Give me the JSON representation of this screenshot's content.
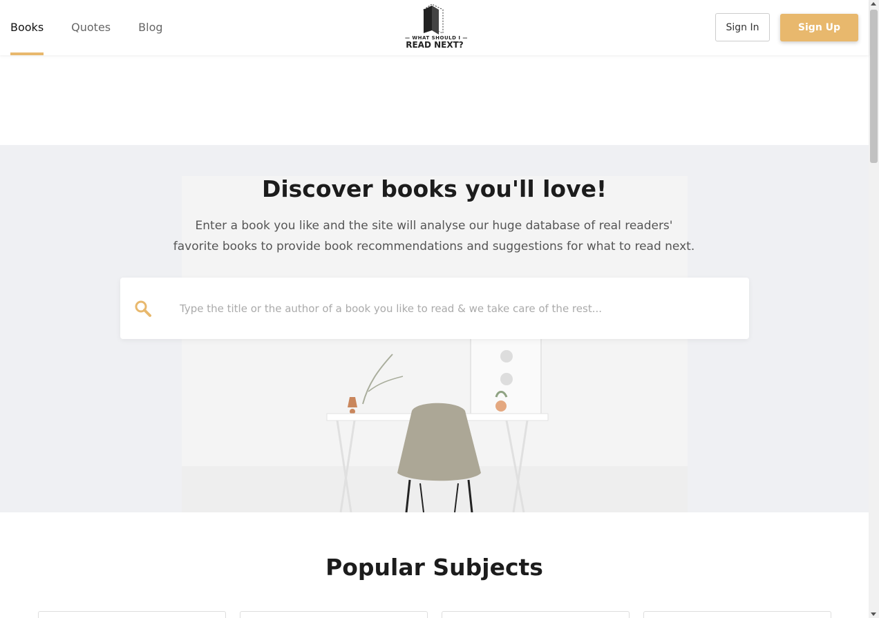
{
  "nav": {
    "items": [
      {
        "label": "Books",
        "active": true
      },
      {
        "label": "Quotes",
        "active": false
      },
      {
        "label": "Blog",
        "active": false
      }
    ]
  },
  "logo": {
    "line1": "— WHAT SHOULD I —",
    "line2": "READ NEXT?"
  },
  "auth": {
    "sign_in": "Sign In",
    "sign_up": "Sign Up"
  },
  "hero": {
    "title": "Discover books you'll love!",
    "subtitle": "Enter a book you like and the site will analyse our huge database of real readers' favorite books to provide book recommendations and suggestions for what to read next.",
    "search_placeholder": "Type the title or the author of a book you like to read & we take care of the rest..."
  },
  "subjects": {
    "title": "Popular Subjects"
  },
  "colors": {
    "accent": "#e8b86d",
    "hero_bg": "#eff0f3"
  },
  "icons": {
    "search": "search-icon",
    "logo": "book-logo-icon"
  }
}
